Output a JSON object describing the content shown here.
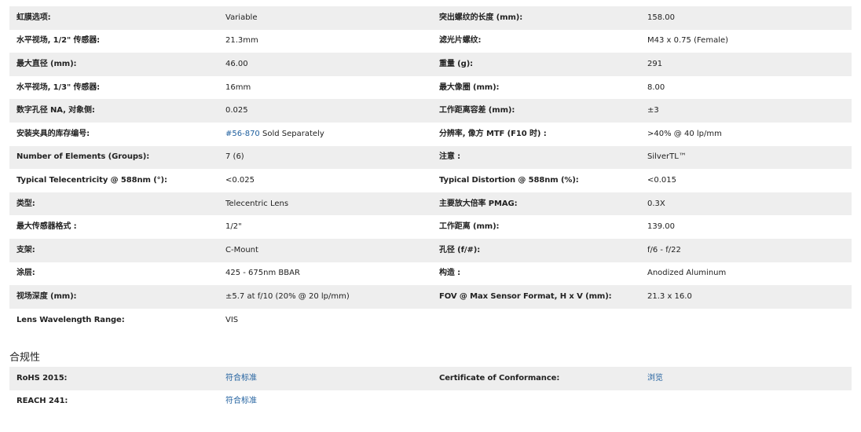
{
  "specs": [
    {
      "l1": "虹膜选项:",
      "v1": "Variable",
      "l2": "突出螺纹的长度 (mm):",
      "v2": "158.00"
    },
    {
      "l1": "水平视场, 1/2\" 传感器:",
      "v1": "21.3mm",
      "l2": "滤光片螺纹:",
      "v2": "M43 x 0.75 (Female)"
    },
    {
      "l1": "最大直径 (mm):",
      "v1": "46.00",
      "l2": "重量 (g):",
      "v2": "291"
    },
    {
      "l1": "水平视场, 1/3\" 传感器:",
      "v1": "16mm",
      "l2": "最大像圈 (mm):",
      "v2": "8.00"
    },
    {
      "l1": "数字孔径 NA, 对象侧:",
      "v1": "0.025",
      "l2": "工作距离容差 (mm):",
      "v2": "±3"
    },
    {
      "l1": "安装夹具的库存编号:",
      "v1_link": "#56-870",
      "v1": " Sold Separately",
      "l2": "分辨率, 像方 MTF (F10 时) :",
      "v2": ">40% @ 40 lp/mm"
    },
    {
      "l1": "Number of Elements (Groups):",
      "v1": "7 (6)",
      "l2": "注意 :",
      "v2": "SilverTL™"
    },
    {
      "l1": "Typical Telecentricity @ 588nm (°):",
      "v1": "<0.025",
      "l2": "Typical Distortion @ 588nm (%):",
      "v2": "<0.015"
    },
    {
      "l1": "类型:",
      "v1": "Telecentric Lens",
      "l2": "主要放大倍率 PMAG:",
      "v2": "0.3X"
    },
    {
      "l1": "最大传感器格式 :",
      "v1": "1/2\"",
      "l2": "工作距离 (mm):",
      "v2": "139.00"
    },
    {
      "l1": "支架:",
      "v1": "C-Mount",
      "l2": "孔径 (f/#):",
      "v2": "f/6 - f/22"
    },
    {
      "l1": "涂层:",
      "v1": "425 - 675nm BBAR",
      "l2": "构造 :",
      "v2": "Anodized Aluminum"
    },
    {
      "l1": "视场深度 (mm):",
      "v1": "±5.7 at f/10 (20% @ 20 lp/mm)",
      "l2": "FOV @ Max Sensor Format, H x V (mm):",
      "v2": "21.3 x 16.0"
    },
    {
      "l1": "Lens Wavelength Range:",
      "v1": "VIS",
      "l2": "",
      "v2": ""
    }
  ],
  "compliance": {
    "title": "合规性",
    "rows": [
      {
        "l1": "RoHS 2015:",
        "v1": "符合标准",
        "l2": "Certificate of Conformance:",
        "v2": "浏览"
      },
      {
        "l1": "REACH 241:",
        "v1": "符合标准",
        "l2": "",
        "v2": ""
      }
    ]
  },
  "colors": {
    "link": "#1f5f9e",
    "row_shade": "#eeeeee",
    "text": "#222222"
  }
}
